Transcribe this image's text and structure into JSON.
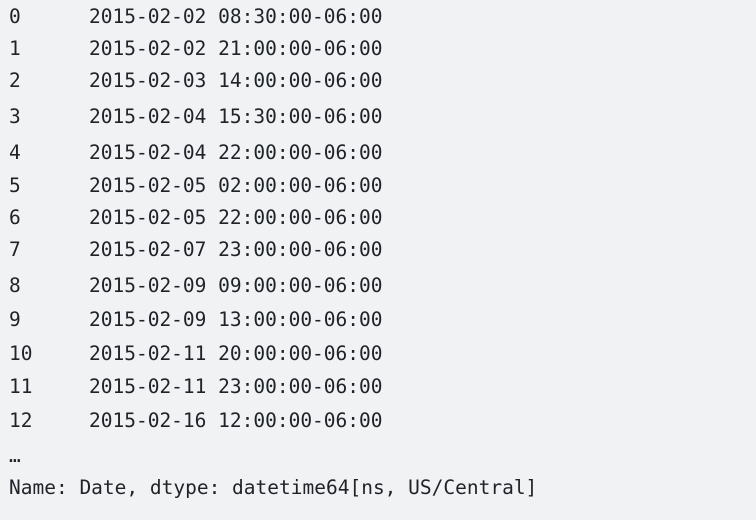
{
  "rows": [
    {
      "index": "0",
      "value": "2015-02-02 08:30:00-06:00"
    },
    {
      "index": "1",
      "value": "2015-02-02 21:00:00-06:00"
    },
    {
      "index": "2",
      "value": "2015-02-03 14:00:00-06:00"
    },
    {
      "index": "3",
      "value": "2015-02-04 15:30:00-06:00"
    },
    {
      "index": "4",
      "value": "2015-02-04 22:00:00-06:00"
    },
    {
      "index": "5",
      "value": "2015-02-05 02:00:00-06:00"
    },
    {
      "index": "6",
      "value": "2015-02-05 22:00:00-06:00"
    },
    {
      "index": "7",
      "value": "2015-02-07 23:00:00-06:00"
    },
    {
      "index": "8",
      "value": "2015-02-09 09:00:00-06:00"
    },
    {
      "index": "9",
      "value": "2015-02-09 13:00:00-06:00"
    },
    {
      "index": "10",
      "value": "2015-02-11 20:00:00-06:00"
    },
    {
      "index": "11",
      "value": "2015-02-11 23:00:00-06:00"
    },
    {
      "index": "12",
      "value": "2015-02-16 12:00:00-06:00"
    }
  ],
  "ellipsis": "…",
  "footer": "Name: Date, dtype: datetime64[ns, US/Central]"
}
